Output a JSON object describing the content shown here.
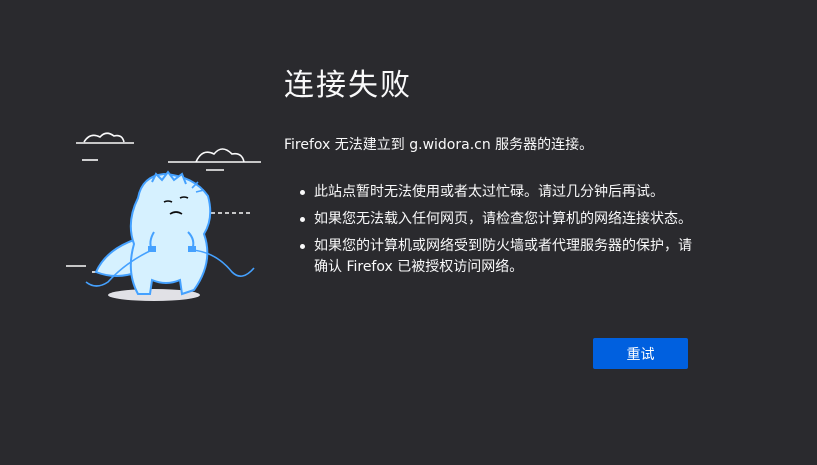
{
  "error": {
    "title": "连接失败",
    "lead": "Firefox 无法建立到 g.widora.cn 服务器的连接。",
    "reasons": [
      "此站点暂时无法使用或者太过忙碌。请过几分钟后再试。",
      "如果您无法载入任何网页，请检查您计算机的网络连接状态。",
      "如果您的计算机或网络受到防火墙或者代理服务器的保护，请确认 Firefox 已被授权访问网络。"
    ],
    "retry_label": "重试"
  },
  "colors": {
    "background": "#2a2a2e",
    "text": "#f9f9fa",
    "button": "#0060df",
    "illustration_accent": "#45a1ff"
  },
  "icons": {
    "illustration": "dinosaur-unplugged-illustration"
  }
}
